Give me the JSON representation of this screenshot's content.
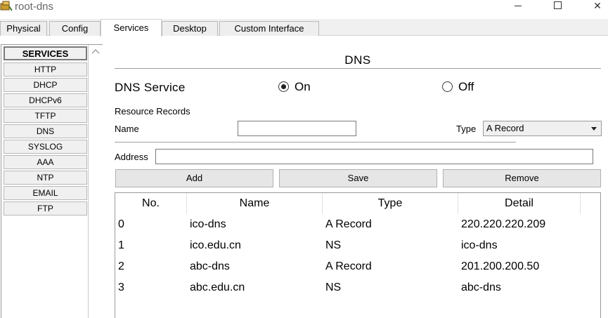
{
  "window": {
    "title": "root-dns"
  },
  "tabs": [
    {
      "label": "Physical"
    },
    {
      "label": "Config"
    },
    {
      "label": "Services"
    },
    {
      "label": "Desktop"
    },
    {
      "label": "Custom Interface"
    }
  ],
  "active_tab": "Services",
  "sidebar": {
    "header": "SERVICES",
    "items": [
      "HTTP",
      "DHCP",
      "DHCPv6",
      "TFTP",
      "DNS",
      "SYSLOG",
      "AAA",
      "NTP",
      "EMAIL",
      "FTP"
    ]
  },
  "dns": {
    "title": "DNS",
    "service_label": "DNS Service",
    "on_label": "On",
    "off_label": "Off",
    "service_state": "On",
    "resource_records_label": "Resource Records",
    "name_label": "Name",
    "name_value": "",
    "type_label": "Type",
    "type_value": "A Record",
    "address_label": "Address",
    "address_value": "",
    "buttons": {
      "add": "Add",
      "save": "Save",
      "remove": "Remove"
    }
  },
  "table": {
    "headers": [
      "No.",
      "Name",
      "Type",
      "Detail"
    ],
    "rows": [
      [
        "0",
        "ico-dns",
        "A Record",
        "220.220.220.209"
      ],
      [
        "1",
        "ico.edu.cn",
        "NS",
        "ico-dns"
      ],
      [
        "2",
        "abc-dns",
        "A Record",
        "201.200.200.50"
      ],
      [
        "3",
        "abc.edu.cn",
        "NS",
        "abc-dns"
      ]
    ]
  },
  "icons": [
    "app-icon",
    "minimize-icon",
    "maximize-icon",
    "close-icon",
    "scroll-up-icon",
    "dropdown-arrow-icon"
  ]
}
